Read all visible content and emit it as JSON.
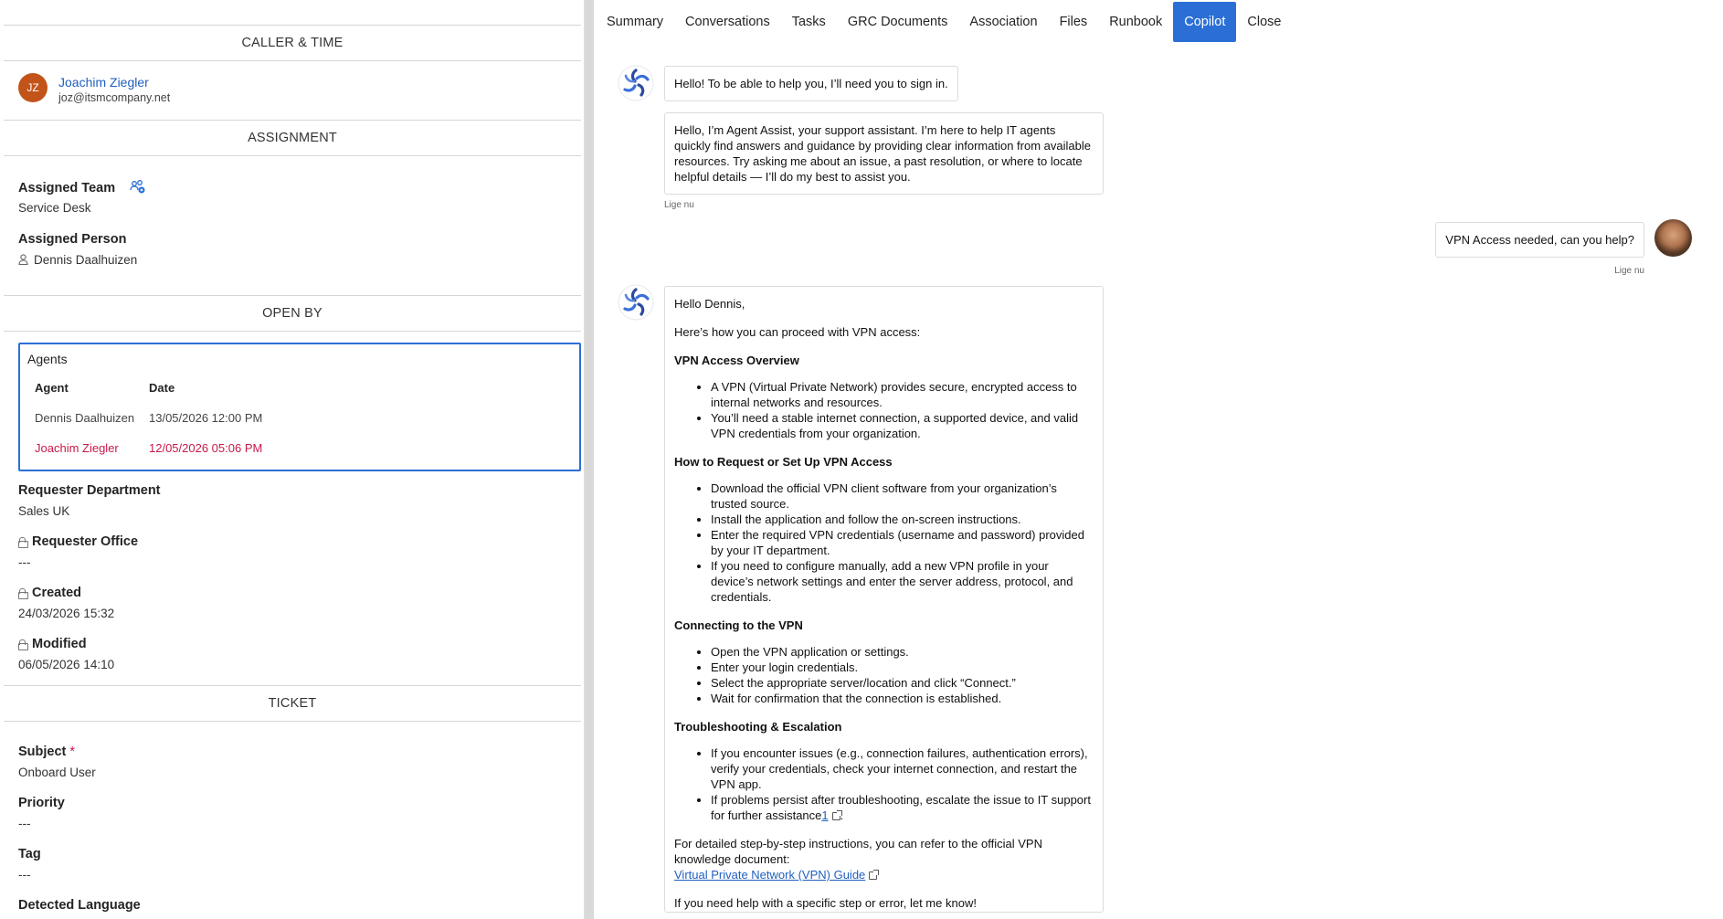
{
  "sections": {
    "caller_time": "CALLER & TIME",
    "assignment": "ASSIGNMENT",
    "open_by": "OPEN BY",
    "ticket": "TICKET"
  },
  "caller": {
    "initials": "JZ",
    "name": "Joachim Ziegler",
    "email": "joz@itsmcompany.net",
    "avatar_color": "#c2541a"
  },
  "assignment": {
    "team_label": "Assigned Team",
    "team_value": "Service Desk",
    "person_label": "Assigned Person",
    "person_value": "Dennis Daalhuizen"
  },
  "agents": {
    "title": "Agents",
    "col_agent": "Agent",
    "col_date": "Date",
    "rows": [
      {
        "agent": "Dennis Daalhuizen",
        "date": "13/05/2026 12:00 PM",
        "highlight": false
      },
      {
        "agent": "Joachim Ziegler",
        "date": "12/05/2026 05:06 PM",
        "highlight": true
      }
    ]
  },
  "fields": {
    "req_dept_label": "Requester Department",
    "req_dept_value": "Sales UK",
    "req_office_label": "Requester Office",
    "req_office_value": "---",
    "created_label": "Created",
    "created_value": "24/03/2026 15:32",
    "modified_label": "Modified",
    "modified_value": "06/05/2026 14:10",
    "subject_label": "Subject",
    "subject_required": "*",
    "subject_value": "Onboard User",
    "priority_label": "Priority",
    "priority_value": "---",
    "tag_label": "Tag",
    "tag_value": "---",
    "lang_label": "Detected Language"
  },
  "tabs": [
    "Summary",
    "Conversations",
    "Tasks",
    "GRC Documents",
    "Association",
    "Files",
    "Runbook",
    "Copilot",
    "Close"
  ],
  "active_tab": "Copilot",
  "colors": {
    "accent": "#2b6fd6",
    "highlight": "#c8184a",
    "link": "#1f5fbf"
  },
  "chat": {
    "msg1": "Hello! To be able to help you, I’ll need you to sign in.",
    "msg2": "Hello, I’m Agent Assist, your support assistant. I’m here to help IT agents quickly find answers and guidance by providing clear information from available resources. Try asking me about an issue, a past resolution, or where to locate helpful details — I’ll do my best to assist you.",
    "stamp1": "Lige nu",
    "user_msg": "VPN Access needed, can you help?",
    "stamp2": "Lige nu",
    "resp": {
      "greeting": "Hello Dennis,",
      "intro": "Here’s how you can proceed with VPN access:",
      "h1": "VPN Access Overview",
      "l1": [
        "A VPN (Virtual Private Network) provides secure, encrypted access to internal networks and resources.",
        "You’ll need a stable internet connection, a supported device, and valid VPN credentials from your organization."
      ],
      "h2": "How to Request or Set Up VPN Access",
      "l2": [
        "Download the official VPN client software from your organization’s trusted source.",
        "Install the application and follow the on-screen instructions.",
        "Enter the required VPN credentials (username and password) provided by your IT department.",
        "If you need to configure manually, add a new VPN profile in your device’s network settings and enter the server address, protocol, and credentials."
      ],
      "h3": "Connecting to the VPN",
      "l3": [
        "Open the VPN application or settings.",
        "Enter your login credentials.",
        "Select the appropriate server/location and click “Connect.”",
        "Wait for confirmation that the connection is established."
      ],
      "h4": "Troubleshooting & Escalation",
      "l4a": "If you encounter issues (e.g., connection failures, authentication errors), verify your credentials, check your internet connection, and restart the VPN app.",
      "l4b_text": "If problems persist after troubleshooting, escalate the issue to IT support for further assistance",
      "l4b_ref": "1",
      "detail": "For detailed step-by-step instructions, you can refer to the official VPN knowledge document:",
      "link": "Virtual Private Network (VPN) Guide",
      "closing": "If you need help with a specific step or error, let me know!"
    }
  }
}
